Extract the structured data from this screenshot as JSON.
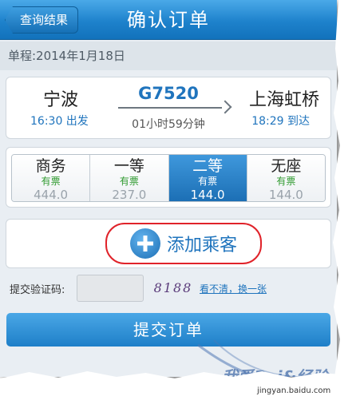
{
  "header": {
    "back_label": "查询结果",
    "title": "确认订单"
  },
  "trip": {
    "date_text": "单程:2014年1月18日"
  },
  "train": {
    "from_station": "宁波",
    "to_station": "上海虹桥",
    "depart_text": "16:30 出发",
    "arrive_text": "18:29 到达",
    "train_no": "G7520",
    "duration": "01小时59分钟"
  },
  "seats": [
    {
      "cls": "商务",
      "avail": "有票",
      "price": "444.0",
      "selected": false
    },
    {
      "cls": "一等",
      "avail": "有票",
      "price": "237.0",
      "selected": false
    },
    {
      "cls": "二等",
      "avail": "有票",
      "price": "144.0",
      "selected": true
    },
    {
      "cls": "无座",
      "avail": "有票",
      "price": "144.0",
      "selected": false
    }
  ],
  "add_passenger": {
    "label": "添加乘客",
    "icon": "plus-circle-icon"
  },
  "captcha": {
    "label": "提交验证码:",
    "input_value": "",
    "image_text": "8188",
    "refresh_link": "看不清，换一张"
  },
  "submit": {
    "label": "提交订单"
  },
  "watermark": {
    "text": "我爱Bai&经验",
    "url": "jingyan.baidu.com"
  },
  "colors": {
    "accent": "#1f74bd",
    "header": "#1e82cc",
    "highlight_ring": "#e0232a",
    "available": "#2f9a2f"
  }
}
